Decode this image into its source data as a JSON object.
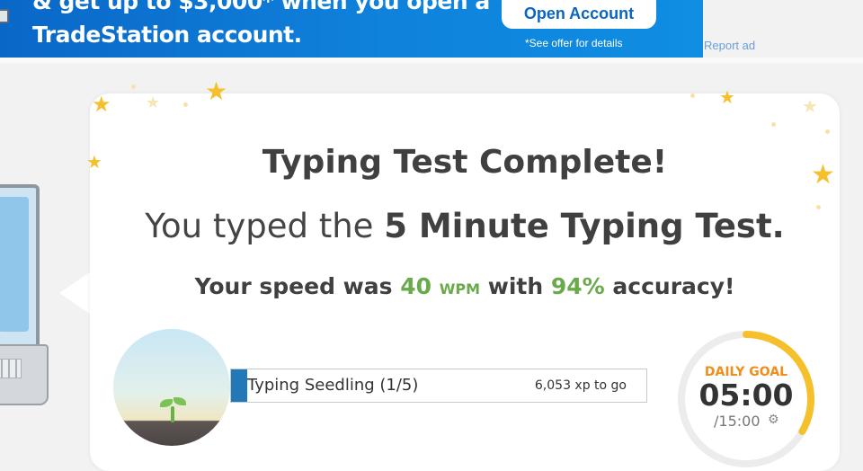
{
  "ad": {
    "line1": "& get up to $3,000* when you open a",
    "line2": "TradeStation account.",
    "cta_label": "Open Account",
    "disclaimer": "*See offer for details",
    "report_label": "Report ad"
  },
  "result": {
    "title": "Typing Test Complete!",
    "subtitle_prefix": "You typed the ",
    "test_name": "5 Minute Typing Test.",
    "speed_prefix": "Your speed was ",
    "wpm_value": "40",
    "wpm_unit": "WPM",
    "speed_middle": " with ",
    "accuracy_value": "94%",
    "speed_suffix": " accuracy!"
  },
  "level": {
    "label": "Typing Seedling (1/5)",
    "xp_to_go": "6,053 xp to go",
    "progress_fraction": 0.04
  },
  "daily_goal": {
    "label": "DAILY GOAL",
    "time": "05:00",
    "total": "/15:00",
    "progress_fraction": 0.333
  },
  "colors": {
    "accent_green": "#6aaa4a",
    "progress_blue": "#2379b8",
    "goal_orange": "#ef8e1c",
    "goal_ring": "#f5c02b"
  }
}
